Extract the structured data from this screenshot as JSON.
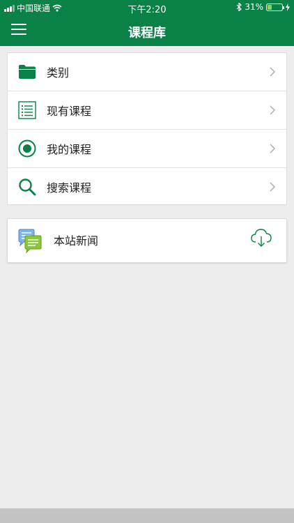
{
  "status_bar": {
    "carrier": "中国联通",
    "time": "下午2:20",
    "battery_percent": "31%",
    "battery_level": 0.31
  },
  "header": {
    "title": "课程库",
    "menu_icon": "hamburger-icon"
  },
  "menu": {
    "items": [
      {
        "label": "类别",
        "icon": "folder-icon"
      },
      {
        "label": "现有课程",
        "icon": "list-icon"
      },
      {
        "label": "我的课程",
        "icon": "target-icon"
      },
      {
        "label": "搜索课程",
        "icon": "search-icon"
      }
    ]
  },
  "news": {
    "label": "本站新闻",
    "icon": "chat-bubbles-icon",
    "action_icon": "cloud-download-icon"
  },
  "colors": {
    "brand": "#0a8146",
    "background": "#ededed"
  }
}
